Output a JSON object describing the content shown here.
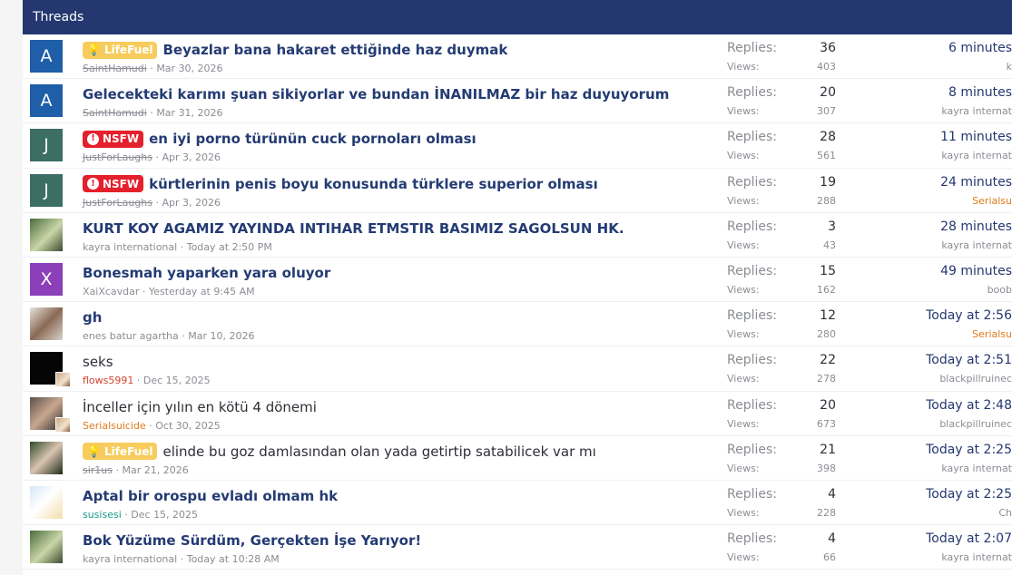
{
  "header": {
    "title": "Threads"
  },
  "threads": [
    {
      "avatar": {
        "kind": "letter",
        "letter": "A",
        "bg": "#1f5ea8"
      },
      "prefix": {
        "text": "LifeFuel",
        "type": "lifefuel"
      },
      "title": "Beyazlar bana hakaret ettiğinde haz duymak",
      "bold": true,
      "author": "SaintHamudi",
      "author_style": "strike",
      "date": "Mar 30, 2026",
      "replies_label": "Replies:",
      "replies": "36",
      "views_label": "Views:",
      "views": "403",
      "latest_date": "6 minutes",
      "latest_user": "k",
      "latest_user_style": "normal"
    },
    {
      "avatar": {
        "kind": "letter",
        "letter": "A",
        "bg": "#1f5ea8"
      },
      "prefix": null,
      "title": "Gelecekteki karımı şuan sikiyorlar ve bundan İNANILMAZ bir haz duyuyorum",
      "bold": true,
      "author": "SaintHamudi",
      "author_style": "strike",
      "date": "Mar 31, 2026",
      "replies_label": "Replies:",
      "replies": "20",
      "views_label": "Views:",
      "views": "307",
      "latest_date": "8 minutes",
      "latest_user": "kayra internat",
      "latest_user_style": "normal"
    },
    {
      "avatar": {
        "kind": "letter",
        "letter": "J",
        "bg": "#3c6e66"
      },
      "prefix": {
        "text": "NSFW",
        "type": "nsfw"
      },
      "title": "en iyi porno türünün cuck pornoları olması",
      "bold": true,
      "author": "JustForLaughs",
      "author_style": "strike",
      "date": "Apr 3, 2026",
      "replies_label": "Replies:",
      "replies": "28",
      "views_label": "Views:",
      "views": "561",
      "latest_date": "11 minutes",
      "latest_user": "kayra internat",
      "latest_user_style": "normal"
    },
    {
      "avatar": {
        "kind": "letter",
        "letter": "J",
        "bg": "#3c6e66"
      },
      "prefix": {
        "text": "NSFW",
        "type": "nsfw"
      },
      "title": "kürtlerinin penis boyu konusunda türklere superior olması",
      "bold": true,
      "author": "JustForLaughs",
      "author_style": "strike",
      "date": "Apr 3, 2026",
      "replies_label": "Replies:",
      "replies": "19",
      "views_label": "Views:",
      "views": "288",
      "latest_date": "24 minutes",
      "latest_user": "Serialsu",
      "latest_user_style": "orange"
    },
    {
      "avatar": {
        "kind": "photo",
        "style": "photo"
      },
      "prefix": null,
      "title": "KURT KOY AGAMIZ YAYINDA INTIHAR ETMSTIR BASIMIZ SAGOLSUN HK.",
      "bold": true,
      "author": "kayra international",
      "author_style": "normal",
      "date": "Today at 2:50 PM",
      "replies_label": "Replies:",
      "replies": "3",
      "views_label": "Views:",
      "views": "43",
      "latest_date": "28 minutes",
      "latest_user": "kayra internat",
      "latest_user_style": "normal"
    },
    {
      "avatar": {
        "kind": "letter",
        "letter": "X",
        "bg": "#8b3fb8"
      },
      "prefix": null,
      "title": "Bonesmah yaparken yara oluyor",
      "bold": true,
      "author": "XaiXcavdar",
      "author_style": "normal",
      "date": "Yesterday at 9:45 AM",
      "replies_label": "Replies:",
      "replies": "15",
      "views_label": "Views:",
      "views": "162",
      "latest_date": "49 minutes",
      "latest_user": "boob",
      "latest_user_style": "normal"
    },
    {
      "avatar": {
        "kind": "photo",
        "style": "face"
      },
      "prefix": null,
      "title": "gh",
      "bold": true,
      "author": "enes batur agartha",
      "author_style": "normal",
      "date": "Mar 10, 2026",
      "replies_label": "Replies:",
      "replies": "12",
      "views_label": "Views:",
      "views": "280",
      "latest_date": "Today at 2:56",
      "latest_user": "Serialsu",
      "latest_user_style": "orange"
    },
    {
      "avatar": {
        "kind": "photo",
        "style": "dark",
        "mini": true
      },
      "prefix": null,
      "title": "seks",
      "bold": false,
      "author": "flows5991",
      "author_style": "red",
      "date": "Dec 15, 2025",
      "replies_label": "Replies:",
      "replies": "22",
      "views_label": "Views:",
      "views": "278",
      "latest_date": "Today at 2:51",
      "latest_user": "blackpillruinec",
      "latest_user_style": "normal"
    },
    {
      "avatar": {
        "kind": "photo",
        "style": "man",
        "mini": true
      },
      "prefix": null,
      "title": "İnceller için yılın en kötü 4 dönemi",
      "bold": false,
      "author": "Serialsuicide",
      "author_style": "orange",
      "date": "Oct 30, 2025",
      "replies_label": "Replies:",
      "replies": "20",
      "views_label": "Views:",
      "views": "673",
      "latest_date": "Today at 2:48",
      "latest_user": "blackpillruinec",
      "latest_user_style": "normal"
    },
    {
      "avatar": {
        "kind": "photo",
        "style": "woman"
      },
      "prefix": {
        "text": "LifeFuel",
        "type": "lifefuel"
      },
      "title": "elinde bu goz damlasından olan yada getirtip satabilicek var mı",
      "bold": false,
      "author": "sir1us",
      "author_style": "strike",
      "date": "Mar 21, 2026",
      "replies_label": "Replies:",
      "replies": "21",
      "views_label": "Views:",
      "views": "398",
      "latest_date": "Today at 2:25",
      "latest_user": "kayra internat",
      "latest_user_style": "normal"
    },
    {
      "avatar": {
        "kind": "photo",
        "style": "anime"
      },
      "prefix": null,
      "title": "Aptal bir orospu evladı olmam hk",
      "bold": true,
      "author": "susisesi",
      "author_style": "teal",
      "date": "Dec 15, 2025",
      "replies_label": "Replies:",
      "replies": "4",
      "views_label": "Views:",
      "views": "228",
      "latest_date": "Today at 2:25",
      "latest_user": "Ch",
      "latest_user_style": "normal"
    },
    {
      "avatar": {
        "kind": "photo",
        "style": "photo"
      },
      "prefix": null,
      "title": "Bok Yüzüme Sürdüm, Gerçekten İşe Yarıyor!",
      "bold": true,
      "author": "kayra international",
      "author_style": "normal",
      "date": "Today at 10:28 AM",
      "replies_label": "Replies:",
      "replies": "4",
      "views_label": "Views:",
      "views": "66",
      "latest_date": "Today at 2:07",
      "latest_user": "kayra internat",
      "latest_user_style": "normal"
    }
  ]
}
